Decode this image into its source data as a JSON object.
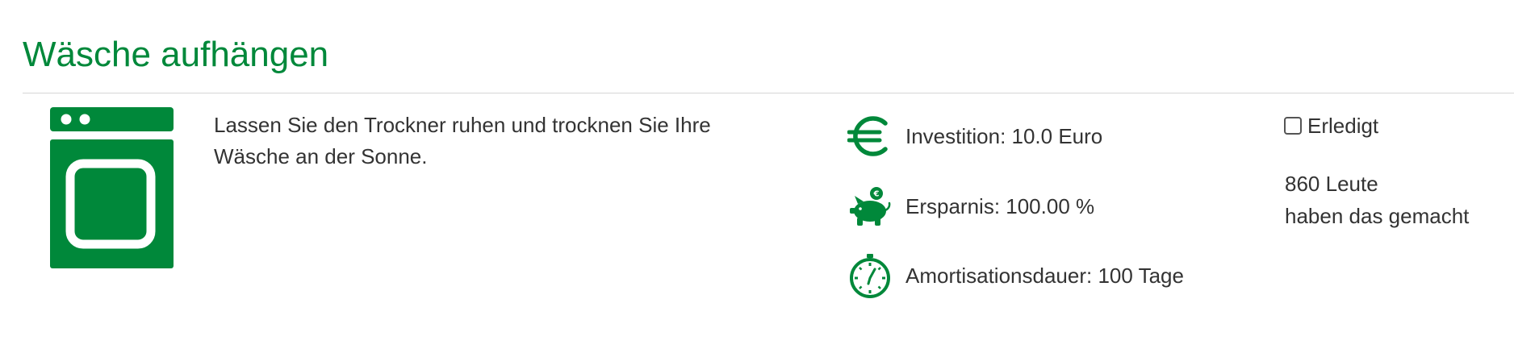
{
  "measure": {
    "title": "Wäsche aufhängen",
    "icon": "washing-machine-icon",
    "description": "Lassen Sie den Trockner ruhen und trocknen Sie Ihre Wäsche an der Sonne."
  },
  "metrics": {
    "investment": {
      "icon": "euro-icon",
      "label": "Investition: 10.0 Euro"
    },
    "savings": {
      "icon": "piggy-bank-icon",
      "label": "Ersparnis: 100.00 %"
    },
    "amortization": {
      "icon": "stopwatch-icon",
      "label": "Amortisationsdauer: 100 Tage"
    }
  },
  "status": {
    "done_label": "Erledigt",
    "done_checked": false,
    "people_count_line": "860 Leute",
    "people_suffix_line": "haben das gemacht"
  },
  "colors": {
    "brand_green": "#00883a",
    "text": "#333333",
    "divider": "#d6d6d6"
  }
}
